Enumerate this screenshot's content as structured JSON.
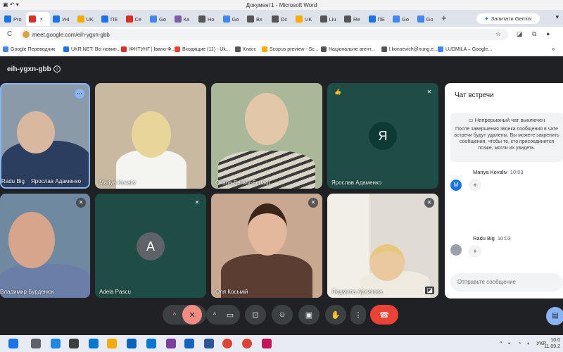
{
  "window": {
    "app_title": "Документ1 - Microsoft Word"
  },
  "browser": {
    "tabs": [
      {
        "label": "Pro",
        "color": "#1a73e8"
      },
      {
        "label": "",
        "color": "#d93025",
        "active": true
      },
      {
        "label": "Уні",
        "color": "#1a73e8"
      },
      {
        "label": "UK",
        "color": "#f9ab00"
      },
      {
        "label": "ПЕ",
        "color": "#1a73e8"
      },
      {
        "label": "Се",
        "color": "#d93025"
      },
      {
        "label": "Go",
        "color": "#4285f4"
      },
      {
        "label": "Ка",
        "color": "#7b5ea7"
      },
      {
        "label": "Но",
        "color": "#555555"
      },
      {
        "label": "Go",
        "color": "#4285f4"
      },
      {
        "label": "Вх",
        "color": "#555555"
      },
      {
        "label": "Ос",
        "color": "#555555"
      },
      {
        "label": "UK",
        "color": "#f9ab00"
      },
      {
        "label": "Liu",
        "color": "#555555"
      },
      {
        "label": "Re",
        "color": "#555555"
      },
      {
        "label": "ПЕ",
        "color": "#1a73e8"
      },
      {
        "label": "Go",
        "color": "#4285f4"
      },
      {
        "label": "Go",
        "color": "#4285f4"
      }
    ],
    "gemini_label": "Запитати Gemini",
    "url": "meet.google.com/eih-ygxn-gbb",
    "bookmarks": [
      {
        "label": "Google Переводчик",
        "color": "#4285f4"
      },
      {
        "label": "UKR.NET: Всі новин...",
        "color": "#1a73e8"
      },
      {
        "label": "ІФНТУНГ | Івано-Ф...",
        "color": "#d93025"
      },
      {
        "label": "Входящие (11) - Uk...",
        "color": "#ea4335"
      },
      {
        "label": "Класс",
        "color": "#555555"
      },
      {
        "label": "Scopus preview - Sc...",
        "color": "#f9ab00"
      },
      {
        "label": "Національне агент...",
        "color": "#555555"
      },
      {
        "label": "l.konsevich@nung.e...",
        "color": "#555555"
      },
      {
        "label": "LUDMILA – Google...",
        "color": "#4285f4"
      }
    ]
  },
  "meet": {
    "meeting_code": "eih-ygxn-gbb",
    "participants": [
      {
        "name": "Radu Big",
        "extra": "Ярослав Адаменко",
        "bg": "#8a9aa8",
        "muted": false,
        "more": true
      },
      {
        "name": "Mariya Kovaliv",
        "bg": "#c9b9a0",
        "muted": false
      },
      {
        "name": "Oxana Senkiv-Fertadi",
        "bg": "#a8b898",
        "muted": false
      },
      {
        "name": "Ярослав Адаменко",
        "bg": "#1e4d45",
        "muted": true,
        "avatar_letter": "Я",
        "avatar_color": "#0d3b33"
      },
      {
        "name": "Владимир Бурденюк",
        "bg": "#6f8aa0",
        "muted": true
      },
      {
        "name": "Adela Pascu",
        "bg": "#1e4d45",
        "muted": true,
        "avatar_letter": "A",
        "avatar_color": "#5f6368"
      },
      {
        "name": "Оля Косьмій",
        "bg": "#c8a890",
        "muted": true
      },
      {
        "name": "Людмила Архипова",
        "bg": "#e0dcd4",
        "muted": true
      }
    ],
    "chat": {
      "title": "Чат встречи",
      "notice_title": "Непрерывный чат выключен",
      "notice_body": "После завершения звонка сообщения в чате встречи будут удалены. Вы можете закрепить сообщения, чтобы те, кто присоединится позже, могли их увидеть.",
      "messages": [
        {
          "author": "Mariya Kovaliv",
          "time": "10:03",
          "avatar": "M",
          "avatar_color": "#1a73e8",
          "bubble": "+"
        },
        {
          "author": "Radu Big",
          "time": "10:03",
          "avatar": "",
          "avatar_color": "#9aa0a6",
          "bubble": "+"
        }
      ],
      "input_placeholder": "Отправьте сообщение"
    }
  },
  "taskbar": {
    "lang": "УКР",
    "time": "10:0",
    "date": "11.09.2"
  }
}
